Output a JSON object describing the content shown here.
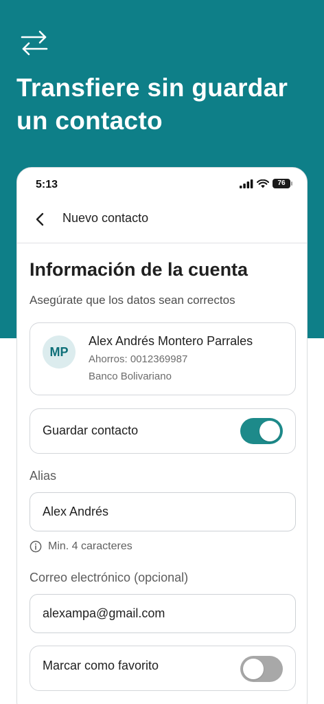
{
  "hero": {
    "title": "Transfiere sin guardar un contacto",
    "icon": "transfer-arrows-icon"
  },
  "status_bar": {
    "time": "5:13",
    "battery": "76",
    "icons": [
      "signal-icon",
      "wifi-icon",
      "battery-icon"
    ]
  },
  "nav": {
    "title": "Nuevo contacto",
    "back_icon": "chevron-left-icon"
  },
  "section": {
    "title": "Información de la cuenta",
    "subtitle": "Asegúrate que los datos sean correctos"
  },
  "contact": {
    "initials": "MP",
    "name": "Alex Andrés Montero Parrales",
    "account": "Ahorros: 0012369987",
    "bank": "Banco Bolivariano"
  },
  "save_contact": {
    "label": "Guardar contacto",
    "enabled": true
  },
  "alias": {
    "label": "Alias",
    "value": "Alex Andrés",
    "hint": "Min. 4 caracteres"
  },
  "email": {
    "label": "Correo electrónico (opcional)",
    "value": "alexampa@gmail.com"
  },
  "favorite": {
    "label": "Marcar como favorito",
    "enabled": false
  },
  "colors": {
    "brand": "#0e7f88",
    "toggle_on": "#1d8a8a",
    "toggle_off": "#a8a8a8"
  }
}
